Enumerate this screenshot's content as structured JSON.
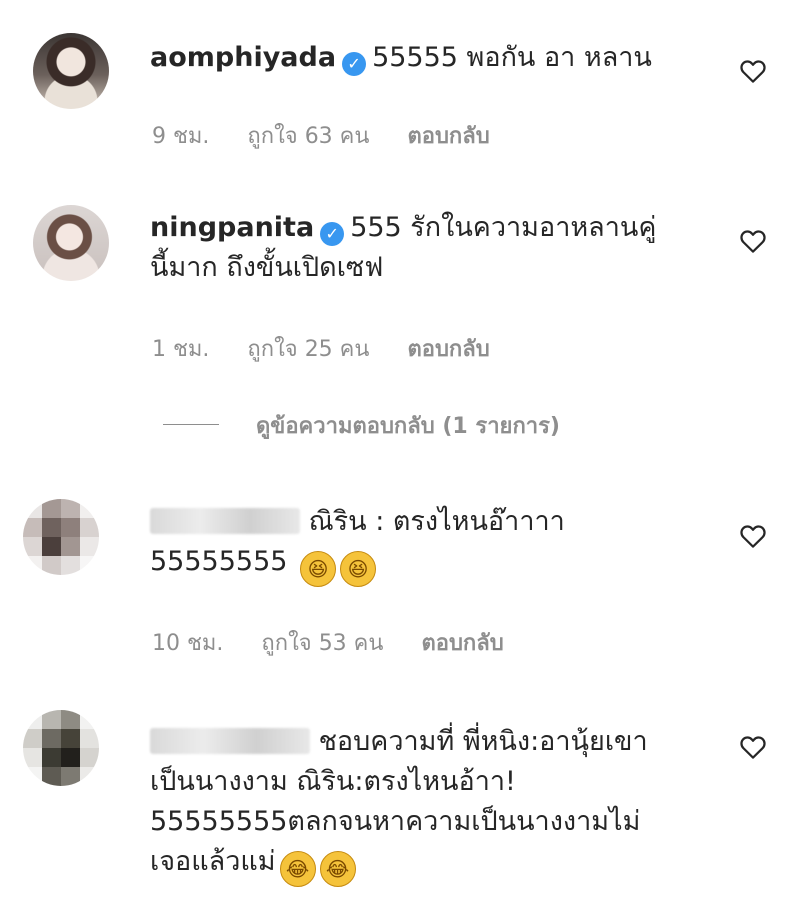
{
  "comments": [
    {
      "username": "aomphiyada",
      "verified": true,
      "text": "55555 พอกัน อา หลาน",
      "time": "9 ชม.",
      "likes": "ถูกใจ 63 คน",
      "reply": "ตอบกลับ"
    },
    {
      "username": "ningpanita",
      "verified": true,
      "text_line1": "555 รักในความอาหลานคู่",
      "text_line2": "นี้มาก ถึงขั้นเปิดเซฟ",
      "time": "1 ชม.",
      "likes": "ถูกใจ 25 คน",
      "reply": "ตอบกลับ",
      "view_replies": "ดูข้อความตอบกลับ (1 รายการ)"
    },
    {
      "username_suffix": "ณิริน",
      "text_line1": ": ตรงไหนอ๊าาาา",
      "text_line2": "55555555",
      "time": "10 ชม.",
      "likes": "ถูกใจ 53 คน",
      "reply": "ตอบกลับ"
    },
    {
      "text_line1": "ชอบความที่ พี่หนิง:อานุ้ยเขา",
      "text_line2": "เป็นนางงาม ณิริน:ตรงไหนอ้าา!",
      "text_line3": "55555555ตลกจนหาความเป็นนางงามไม่",
      "text_line4": "เจอแล้วแม่"
    }
  ],
  "icons": {
    "heart": "heart-icon",
    "verified": "verified-badge-icon",
    "emoji_laugh": "rolling-laughing-emoji-icon",
    "emoji_tears": "tears-of-joy-emoji-icon"
  },
  "colors": {
    "text": "#262626",
    "meta": "#8e8e8e",
    "verified": "#3897f0"
  }
}
